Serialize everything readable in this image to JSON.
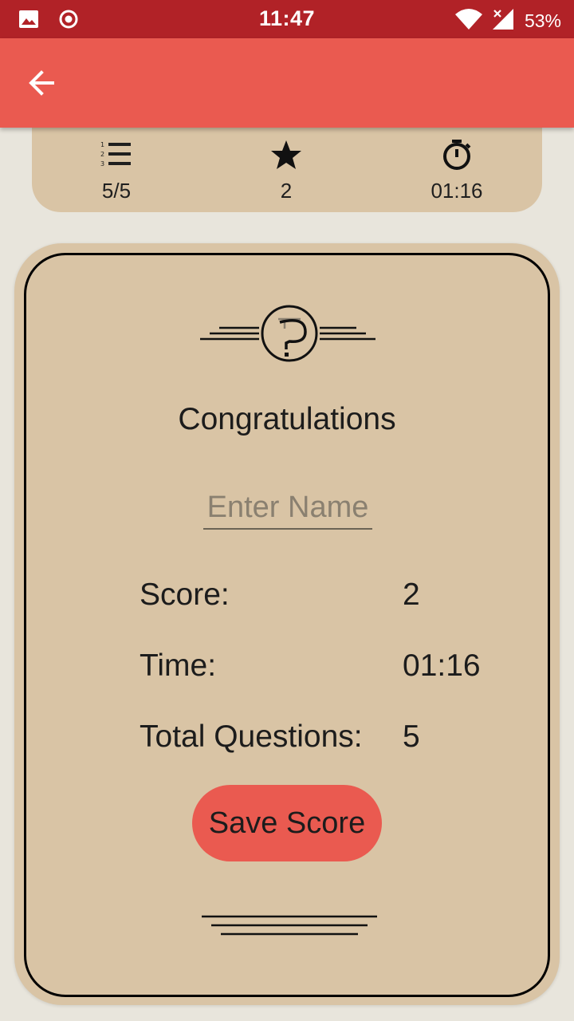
{
  "status_bar": {
    "time": "11:47",
    "battery": "53%",
    "icons": [
      "image-icon",
      "record-icon",
      "wifi-icon",
      "signal-icon",
      "battery-icon"
    ]
  },
  "app_bar": {
    "back_icon": "arrow-left-icon",
    "color": "#ea5a50"
  },
  "stats": {
    "questions": {
      "icon": "numbered-list-icon",
      "value": "5/5"
    },
    "score": {
      "icon": "star-icon",
      "value": "2"
    },
    "timer": {
      "icon": "stopwatch-icon",
      "value": "01:16"
    }
  },
  "result_card": {
    "logo_icon": "quiz-logo-icon",
    "heading": "Congratulations",
    "name_placeholder": "Enter Name",
    "name_value": "",
    "rows": [
      {
        "label": "Score:",
        "value": "2"
      },
      {
        "label": "Time:",
        "value": "01:16"
      },
      {
        "label": "Total Questions:",
        "value": "5"
      }
    ],
    "save_label": "Save Score"
  },
  "colors": {
    "status_bar": "#b12227",
    "accent": "#ea5a50",
    "card": "#d9c4a5",
    "background": "#e8e5dc"
  }
}
